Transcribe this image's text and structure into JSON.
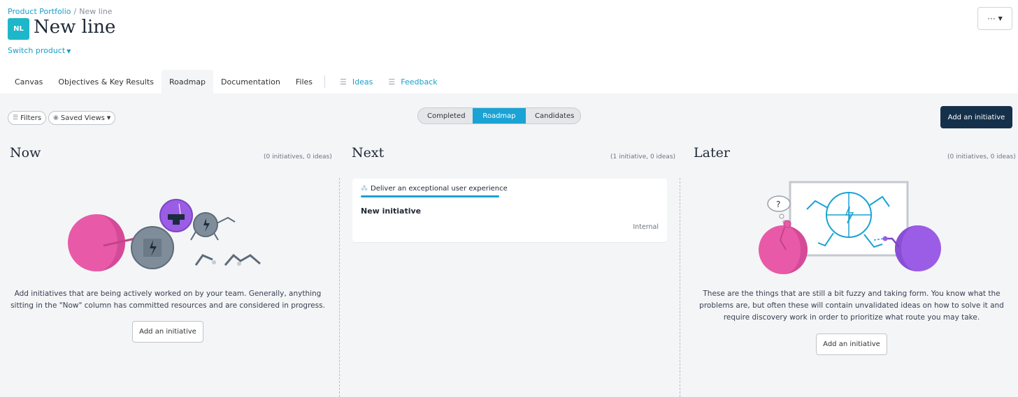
{
  "breadcrumb": {
    "parent": "Product Portfolio",
    "separator": "/",
    "current": "New line"
  },
  "product": {
    "logo_initials": "NL",
    "title": "New line",
    "switch_label": "Switch product",
    "logo_color": "#1db7c9"
  },
  "more_button": {
    "label": "···"
  },
  "tabs": [
    {
      "label": "Canvas"
    },
    {
      "label": "Objectives & Key Results"
    },
    {
      "label": "Roadmap",
      "active": true
    },
    {
      "label": "Documentation"
    },
    {
      "label": "Files"
    },
    {
      "label": "Ideas",
      "icon": "filter-lines-icon"
    },
    {
      "label": "Feedback",
      "icon": "filter-lines-icon"
    }
  ],
  "toolbar": {
    "filters_label": "Filters",
    "saved_views_label": "Saved Views",
    "view_toggle": [
      "Completed",
      "Roadmap",
      "Candidates"
    ],
    "active_view": "Roadmap",
    "add_initiative_label": "Add an initiative"
  },
  "columns": {
    "now": {
      "title": "Now",
      "meta": "(0 initiatives, 0 ideas)",
      "description": "Add initiatives that are being actively worked on by your team. Generally, anything sitting in the \"Now\" column has committed resources and are considered in progress.",
      "button_label": "Add an initiative"
    },
    "next": {
      "title": "Next",
      "meta": "(1 initiative, 0 ideas)",
      "card": {
        "objective": "Deliver an exceptional user experience",
        "title": "New initiative",
        "tag": "Internal"
      }
    },
    "later": {
      "title": "Later",
      "meta": "(0 initiatives, 0 ideas)",
      "description": "These are the things that are still a bit fuzzy and taking form. You know what the problems are, but often these will contain unvalidated ideas on how to solve it and require discovery work in order to prioritize what route you may take.",
      "button_label": "Add an initiative"
    }
  },
  "colors": {
    "accent": "#1aa3d4",
    "primary_button": "#15304a",
    "pink": "#e85aa8",
    "purple": "#9b5de5",
    "gray_robot": "#7f8c9a"
  }
}
